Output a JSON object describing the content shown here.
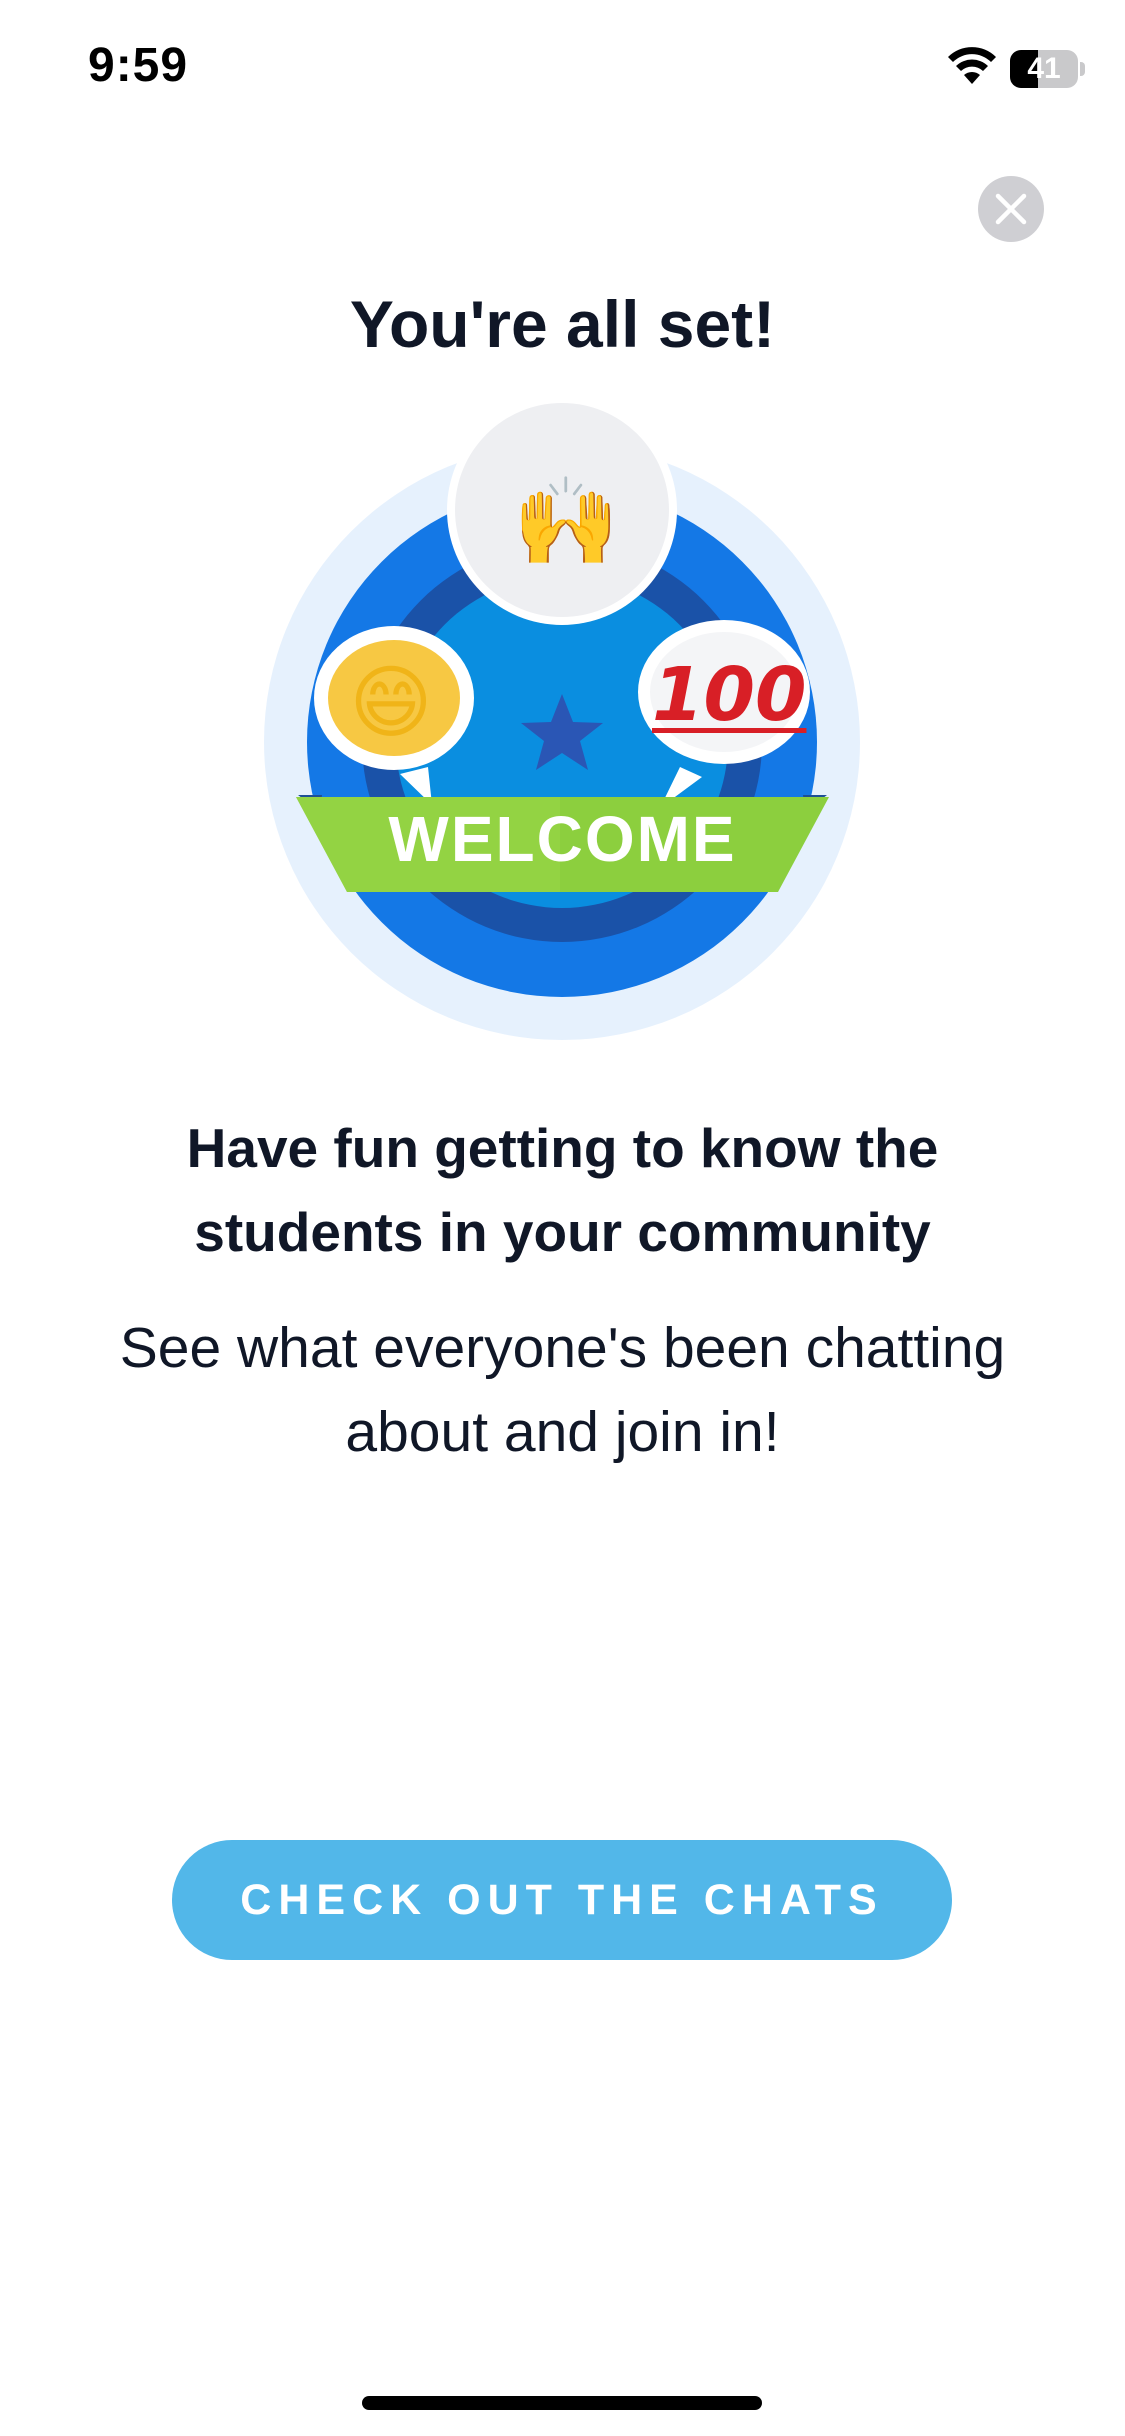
{
  "status_bar": {
    "time": "9:59",
    "battery_text": "41",
    "battery_level": 0.41,
    "wifi_icon": "wifi-icon"
  },
  "close": {
    "icon": "close-icon"
  },
  "title": "You're all set!",
  "badge": {
    "banner_text": "WELCOME",
    "emojis": {
      "raised_hands": "🙌",
      "grinning_face": "😄",
      "hundred_points": "100"
    },
    "colors": {
      "halo": "#e6f1fd",
      "outer_ring": "#1478e6",
      "inner_ring": "#1a52a8",
      "center": "#0a8ee0",
      "star": "#2a56b5",
      "banner": "#8ccf3e"
    }
  },
  "headline": "Have fun getting to know the students in your community",
  "subtext": "See what everyone's been chatting about and join in!",
  "cta": {
    "label": "CHECK OUT THE CHATS",
    "color": "#52b7e9"
  }
}
